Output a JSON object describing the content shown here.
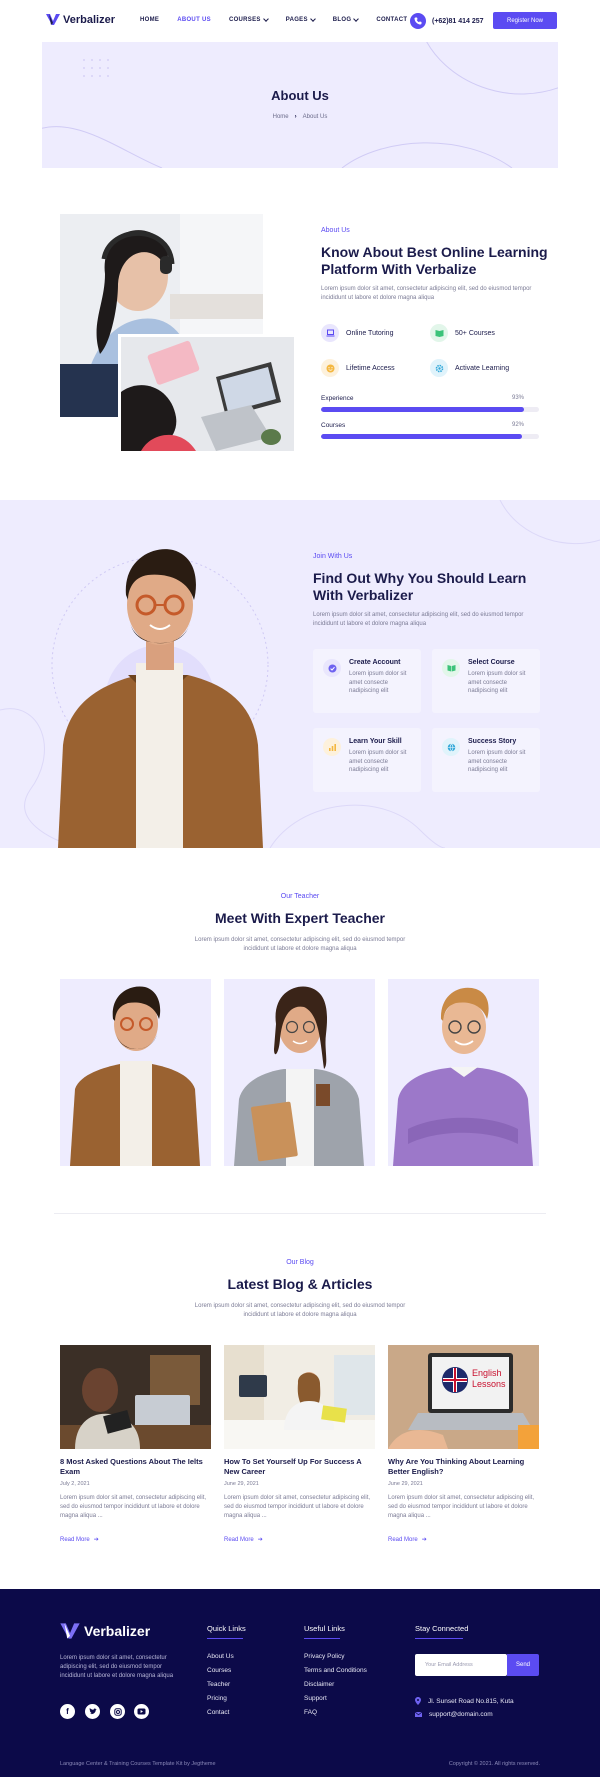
{
  "header": {
    "logo_text": "Verbalizer",
    "nav": [
      {
        "label": "HOME",
        "dropdown": false
      },
      {
        "label": "ABOUT US",
        "dropdown": false,
        "active": true
      },
      {
        "label": "COURSES",
        "dropdown": true
      },
      {
        "label": "PAGES",
        "dropdown": true
      },
      {
        "label": "BLOG",
        "dropdown": true
      },
      {
        "label": "CONTACT",
        "dropdown": false
      }
    ],
    "phone": "(+62)81 414 257",
    "register_label": "Register Now"
  },
  "hero": {
    "title": "About Us",
    "breadcrumb_home": "Home",
    "breadcrumb_current": "About Us"
  },
  "about": {
    "eyebrow": "About Us",
    "heading": "Know About Best Online Learning Platform With Verbalize",
    "text": "Lorem ipsum dolor sit amet, consectetur adipiscing elit, sed do eiusmod tempor incididunt ut labore et dolore magna aliqua",
    "features": [
      "Online Tutoring",
      "50+ Courses",
      "Lifetime Access",
      "Activate Learning"
    ],
    "skills": [
      {
        "label": "Experience",
        "percent_text": "93%",
        "value": 0.93
      },
      {
        "label": "Courses",
        "percent_text": "92%",
        "value": 0.92
      }
    ]
  },
  "why": {
    "eyebrow": "Join With Us",
    "heading": "Find Out Why You Should Learn With Verbalizer",
    "text": "Lorem ipsum dolor sit amet, consectetur adipiscing elit, sed do eiusmod tempor incididunt ut labore et dolore magna aliqua",
    "cards": [
      {
        "title": "Create Account",
        "desc": "Lorem ipsum dolor sit amet consecte nadipiscing elit"
      },
      {
        "title": "Select Course",
        "desc": "Lorem ipsum dolor sit amet consecte nadipiscing elit"
      },
      {
        "title": "Learn Your Skill",
        "desc": "Lorem ipsum dolor sit amet consecte nadipiscing elit"
      },
      {
        "title": "Success Story",
        "desc": "Lorem ipsum dolor sit amet consecte nadipiscing elit"
      }
    ]
  },
  "teachers": {
    "eyebrow": "Our Teacher",
    "heading": "Meet With Expert Teacher",
    "text": "Lorem ipsum dolor sit amet, consectetur adipiscing elit, sed do eiusmod tempor incididunt ut labore et dolore magna aliqua"
  },
  "blog": {
    "eyebrow": "Our Blog",
    "heading": "Latest Blog & Articles",
    "text": "Lorem ipsum dolor sit amet, consectetur adipiscing elit, sed do eiusmod tempor incididunt ut labore et dolore magna aliqua",
    "posts": [
      {
        "title": "8 Most Asked Questions About The Ielts Exam",
        "date": "July 2, 2021",
        "desc": "Lorem ipsum dolor sit amet, consectetur adipiscing elit, sed do eiusmod tempor incididunt ut labore et dolore magna aliqua ...",
        "read_more": "Read More"
      },
      {
        "title": "How To Set Yourself Up For Success A New Career",
        "date": "June 29, 2021",
        "desc": "Lorem ipsum dolor sit amet, consectetur adipiscing elit, sed do eiusmod tempor incididunt ut labore et dolore magna aliqua ...",
        "read_more": "Read More"
      },
      {
        "title": "Why Are You Thinking About Learning Better English?",
        "date": "June 29, 2021",
        "desc": "Lorem ipsum dolor sit amet, consectetur adipiscing elit, sed do eiusmod tempor incididunt ut labore et dolore magna aliqua ...",
        "read_more": "Read More",
        "image_text_1": "English",
        "image_text_2": "Lessons"
      }
    ]
  },
  "footer": {
    "logo_text": "Verbalizer",
    "about": "Lorem ipsum dolor sit amet, consectetur adipiscing elit, sed do eiusmod tempor incididunt ut labore et dolore magna aliqua",
    "quick_links_title": "Quick Links",
    "quick_links": [
      "About Us",
      "Courses",
      "Teacher",
      "Pricing",
      "Contact"
    ],
    "useful_links_title": "Useful Links",
    "useful_links": [
      "Privacy Policy",
      "Terms and Conditions",
      "Disclaimer",
      "Support",
      "FAQ"
    ],
    "stay_title": "Stay Connected",
    "email_placeholder": "Your Email Address",
    "send_label": "Send",
    "address": "Jl. Sunset Road No.815, Kuta",
    "email": "support@domain.com",
    "credit": "Language Center & Training Courses Template Kit by Jegtheme",
    "copyright": "Copyright © 2021. All rights reserved."
  },
  "colors": {
    "primary": "#5b4bf2",
    "dark": "#1b1b4b",
    "footer_bg": "#0c0a49",
    "light_bg": "#eeecfe"
  }
}
